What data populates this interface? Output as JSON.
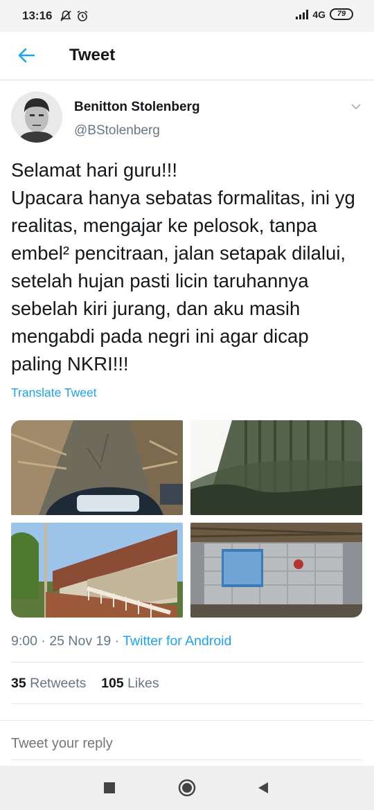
{
  "status_bar": {
    "time": "13:16",
    "network": "4G",
    "battery": "79"
  },
  "header": {
    "title": "Tweet",
    "accent_color": "#1da1f2"
  },
  "tweet": {
    "author_name": "Benitton Stolenberg",
    "author_handle": "@BStolenberg",
    "text": "Selamat hari guru!!!\nUpacara hanya sebatas formalitas, ini yg realitas, mengajar ke pelosok, tanpa embel² pencitraan, jalan setapak dilalui, setelah hujan pasti licin taruhannya sebelah kiri jurang, dan aku masih mengabdi pada negri ini agar dicap paling NKRI!!!",
    "translate_label": "Translate Tweet",
    "time": "9:00",
    "date": "25 Nov 19",
    "separator": " · ",
    "source": "Twitter for Android",
    "retweets_count": "35",
    "retweets_label": "Retweets",
    "likes_count": "105",
    "likes_label": "Likes"
  },
  "reply": {
    "placeholder": "Tweet your reply"
  },
  "icons": {
    "back": "back-arrow-icon",
    "caret": "chevron-down-icon",
    "nav": [
      "recents-square-icon",
      "home-circle-icon",
      "back-triangle-icon"
    ]
  }
}
